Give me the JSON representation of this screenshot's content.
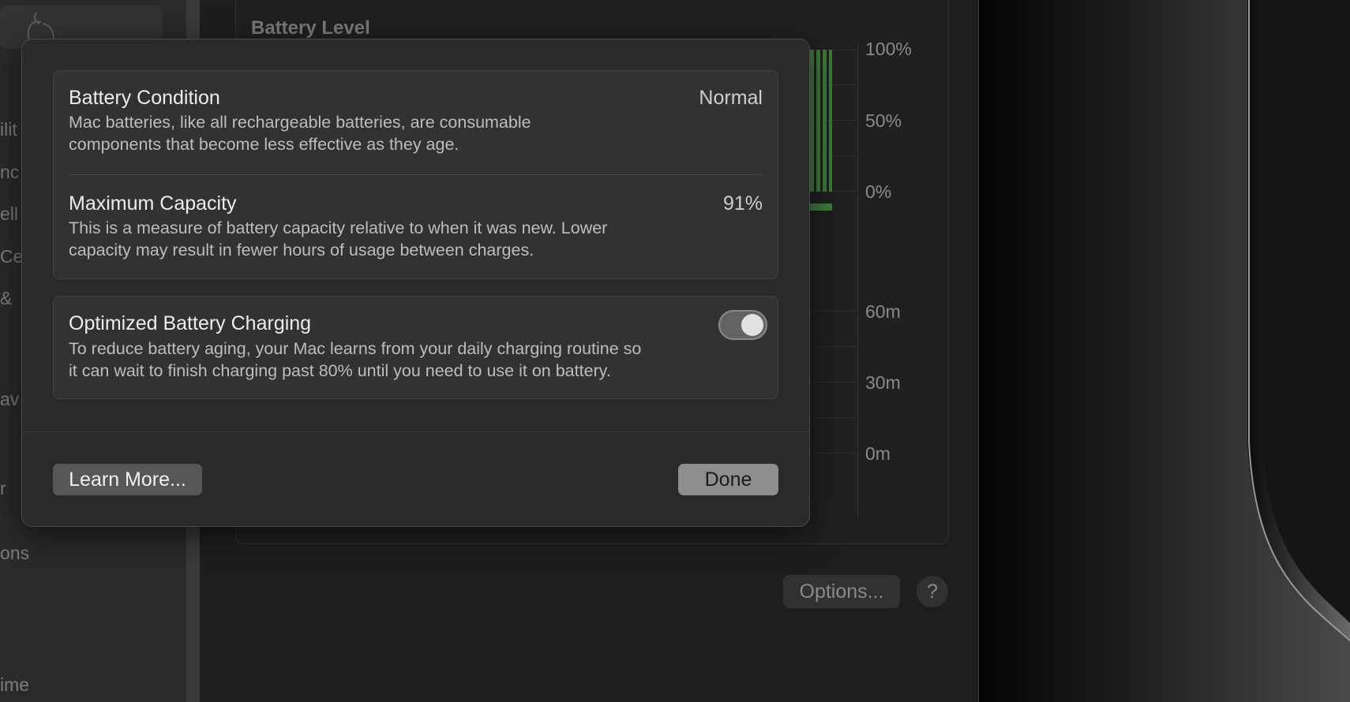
{
  "background": {
    "sidebar_fragments": [
      "ilit",
      "nc",
      "ell",
      "Ce",
      "&",
      "av",
      "r",
      "ons",
      "ime"
    ],
    "chart": {
      "title": "Battery Level",
      "level_ticks": [
        "100%",
        "50%",
        "0%"
      ],
      "time_ticks": [
        "60m",
        "30m",
        "0m"
      ]
    },
    "options_label": "Options...",
    "help_label": "?"
  },
  "sheet": {
    "battery_condition": {
      "title": "Battery Condition",
      "value": "Normal",
      "description_line1": "Mac batteries, like all rechargeable batteries, are consumable",
      "description_line2": "components that become less effective as they age."
    },
    "maximum_capacity": {
      "title": "Maximum Capacity",
      "value": "91%",
      "description_line1": "This is a measure of battery capacity relative to when it was new. Lower",
      "description_line2": "capacity may result in fewer hours of usage between charges."
    },
    "optimized_charging": {
      "title": "Optimized Battery Charging",
      "enabled": true,
      "description_line1": "To reduce battery aging, your Mac learns from your daily charging routine so",
      "description_line2": "it can wait to finish charging past 80% until you need to use it on battery."
    },
    "learn_more_label": "Learn More...",
    "done_label": "Done"
  },
  "colors": {
    "chart_bar": "#3e7a3a",
    "toggle_on": "#636365",
    "done_button": "#8e8e90"
  }
}
